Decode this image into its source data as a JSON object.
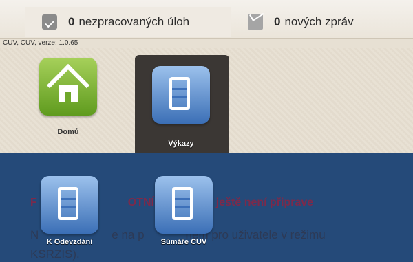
{
  "header": {
    "tasks": {
      "count": "0",
      "label": "nezpracovaných úloh"
    },
    "messages": {
      "count": "0",
      "label": "nových zpráv"
    }
  },
  "version_text": "CUV, CUV, verze: 1.0.65",
  "tiles": [
    {
      "label": "Domů"
    },
    {
      "label": "Výkazy"
    },
    {
      "label": "K Odevzdání"
    },
    {
      "label": "Súmáře CUV"
    }
  ],
  "message": {
    "line1_start": "F",
    "line1_mid": "OTNÍ",
    "line1_end": "Portál ještě není připrave",
    "line2_start": "N",
    "line2_mid": "e na p",
    "line2_end": "ném pro uživatele v režimu",
    "line3": "KSRZIS)."
  }
}
